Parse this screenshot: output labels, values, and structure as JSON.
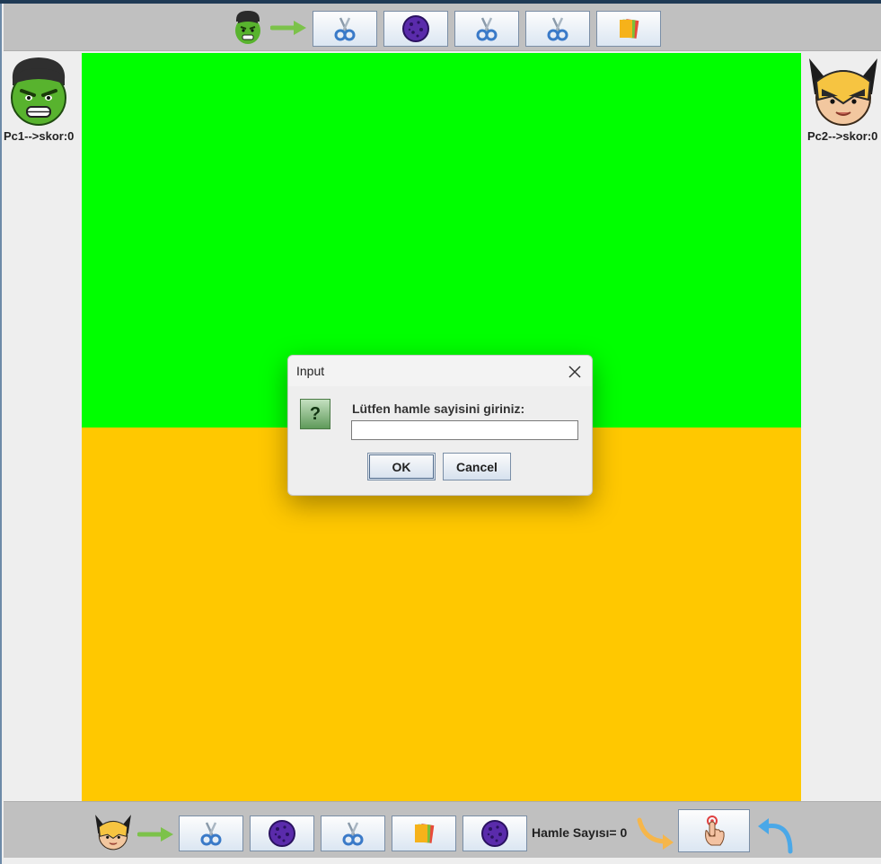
{
  "top_bar": {
    "player_face_icon": "hulk-face-icon",
    "arrow_icon": "green-arrow-icon",
    "items": [
      "scissors-icon",
      "rock-icon",
      "scissors-icon",
      "scissors-icon",
      "paper-icon"
    ]
  },
  "bottom_bar": {
    "player_face_icon": "wolverine-face-icon",
    "arrow_icon": "green-arrow-icon",
    "items": [
      "scissors-icon",
      "rock-icon",
      "scissors-icon",
      "paper-icon",
      "rock-icon"
    ],
    "move_count_label": "Hamle Sayısı= 0",
    "left_curve_arrow": "yellow-curved-arrow-icon",
    "action_button_icon": "tap-hand-icon",
    "right_curve_arrow": "blue-undo-arrow-icon"
  },
  "left_player": {
    "face_icon": "hulk-face-icon",
    "score_label": "Pc1-->skor:0"
  },
  "right_player": {
    "face_icon": "wolverine-face-icon",
    "score_label": "Pc2-->skor:0"
  },
  "board": {
    "top_color": "#00ff00",
    "bottom_color": "#ffc800"
  },
  "dialog": {
    "title": "Input",
    "message": "Lütfen hamle sayisini giriniz:",
    "input_value": "",
    "ok_label": "OK",
    "cancel_label": "Cancel",
    "icon": "question-icon",
    "question_glyph": "?"
  }
}
